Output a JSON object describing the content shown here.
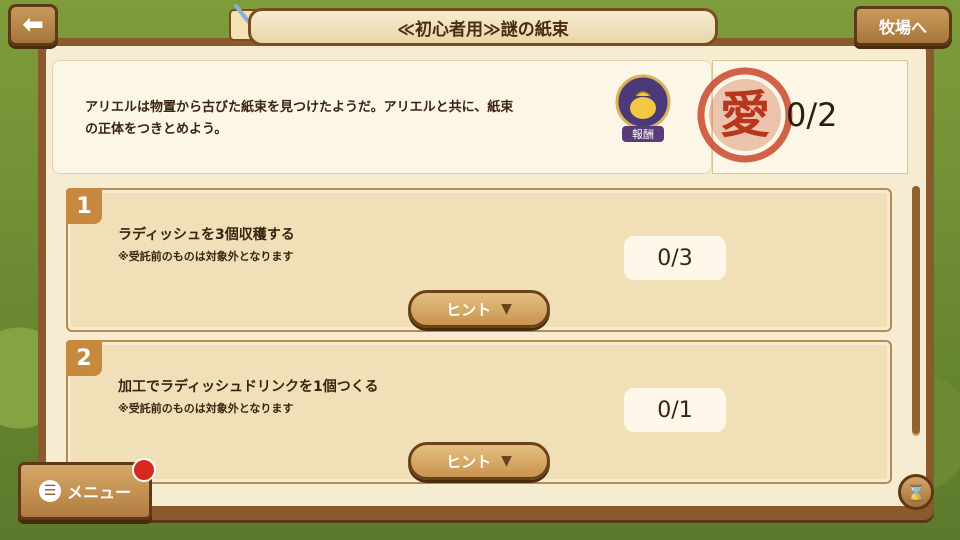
{
  "header": {
    "back_icon": "back-arrow-icon",
    "title": "≪初心者用≫謎の紙束",
    "ranch_button": "牧場へ"
  },
  "quest": {
    "description_line1": "アリエルは物置から古びた紙束を見つけたようだ。アリエルと共に、紙束",
    "description_line2": "の正体をつきとめよう。",
    "reward_label": "報酬",
    "stamp_char": "愛",
    "reward_count": "0/2"
  },
  "tasks": [
    {
      "number": "1",
      "title": "ラディッシュを3個収穫する",
      "note": "※受託前のものは対象外となります",
      "progress": "0/3",
      "hint_label": "ヒント"
    },
    {
      "number": "2",
      "title": "加工でラディッシュドリンクを1個つくる",
      "note": "※受託前のものは対象外となります",
      "progress": "0/1",
      "hint_label": "ヒント"
    }
  ],
  "menu": {
    "label": "メニュー"
  },
  "colors": {
    "wood_dark": "#5d3a17",
    "parchment": "#f6ecd2",
    "stamp_red": "#c9472a"
  }
}
